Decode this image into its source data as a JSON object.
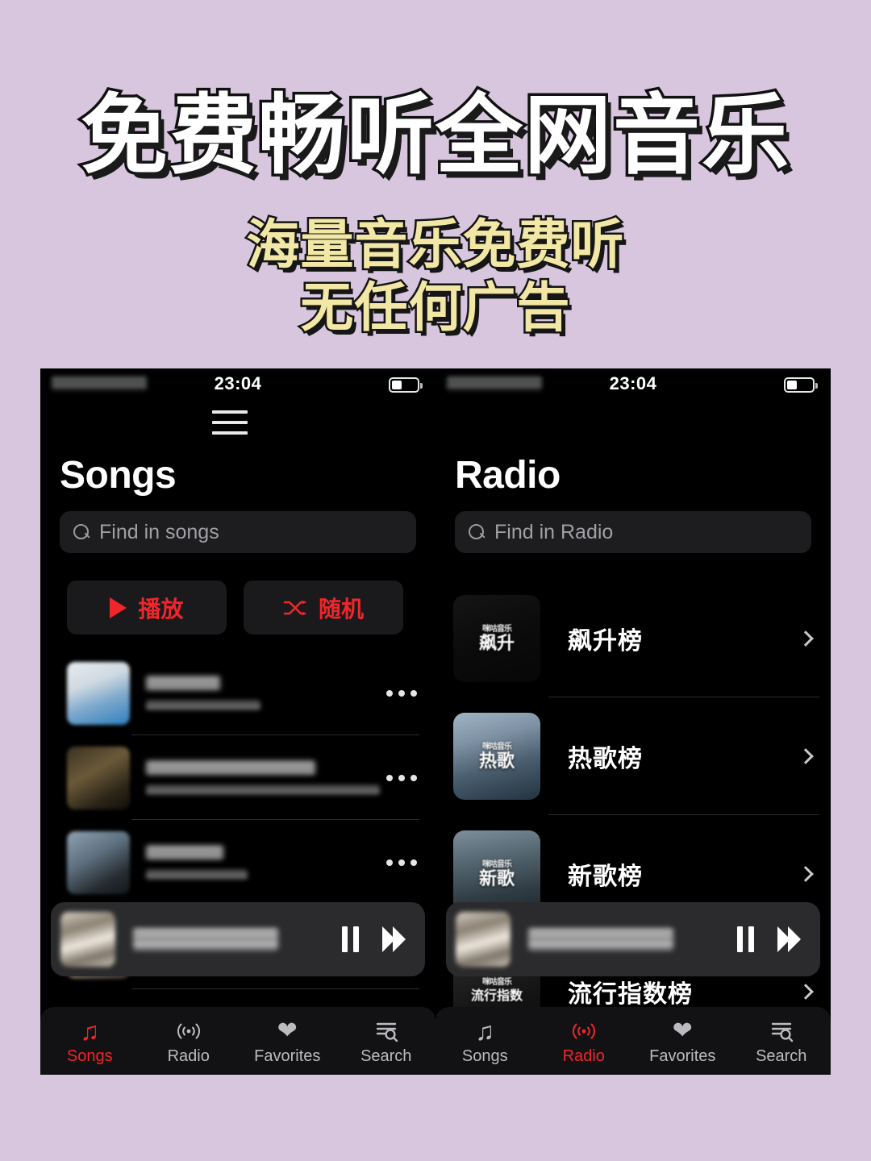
{
  "poster": {
    "headline": "免费畅听全网音乐",
    "sub_line1": "海量音乐免费听",
    "sub_line2": "无任何广告",
    "background_color": "#d7c6de",
    "headline_color": "#ffffff",
    "sub_color": "#f2e7a4",
    "accent_color": "#f0262c"
  },
  "status_bar": {
    "time": "23:04",
    "battery_level": "36%"
  },
  "left_pane": {
    "title": "Songs",
    "search": {
      "placeholder": "Find in songs",
      "icon": "search-icon"
    },
    "buttons": [
      {
        "label": "播放",
        "icon": "play-icon"
      },
      {
        "label": "随机",
        "icon": "shuffle-icon"
      }
    ],
    "songs": [
      {
        "title": "",
        "subtitle": "",
        "redacted": true
      },
      {
        "title": "",
        "subtitle": "",
        "redacted": true
      },
      {
        "title": "",
        "subtitle": "",
        "redacted": true
      },
      {
        "title": "",
        "subtitle": "",
        "redacted": true
      }
    ],
    "more_icon": "more-horizontal-icon",
    "active_tab": "Songs"
  },
  "right_pane": {
    "title": "Radio",
    "search": {
      "placeholder": "Find in Radio",
      "icon": "search-icon"
    },
    "radio_items": [
      {
        "label": "飙升榜",
        "thumb_tiny": "咪咕音乐",
        "thumb_big": "飙升"
      },
      {
        "label": "热歌榜",
        "thumb_tiny": "咪咕音乐",
        "thumb_big": "热歌"
      },
      {
        "label": "新歌榜",
        "thumb_tiny": "咪咕音乐",
        "thumb_big": "新歌"
      },
      {
        "label": "流行指数榜",
        "thumb_tiny": "咪咕音乐",
        "thumb_big": "流行指数"
      }
    ],
    "active_tab": "Radio"
  },
  "mini_player": {
    "track_title": "",
    "redacted": true,
    "pause_icon": "pause-icon",
    "next_icon": "fast-forward-icon"
  },
  "tabs": [
    {
      "label": "Songs",
      "icon": "music-note-icon"
    },
    {
      "label": "Radio",
      "icon": "broadcast-icon"
    },
    {
      "label": "Favorites",
      "icon": "heart-icon"
    },
    {
      "label": "Search",
      "icon": "list-search-icon"
    }
  ]
}
